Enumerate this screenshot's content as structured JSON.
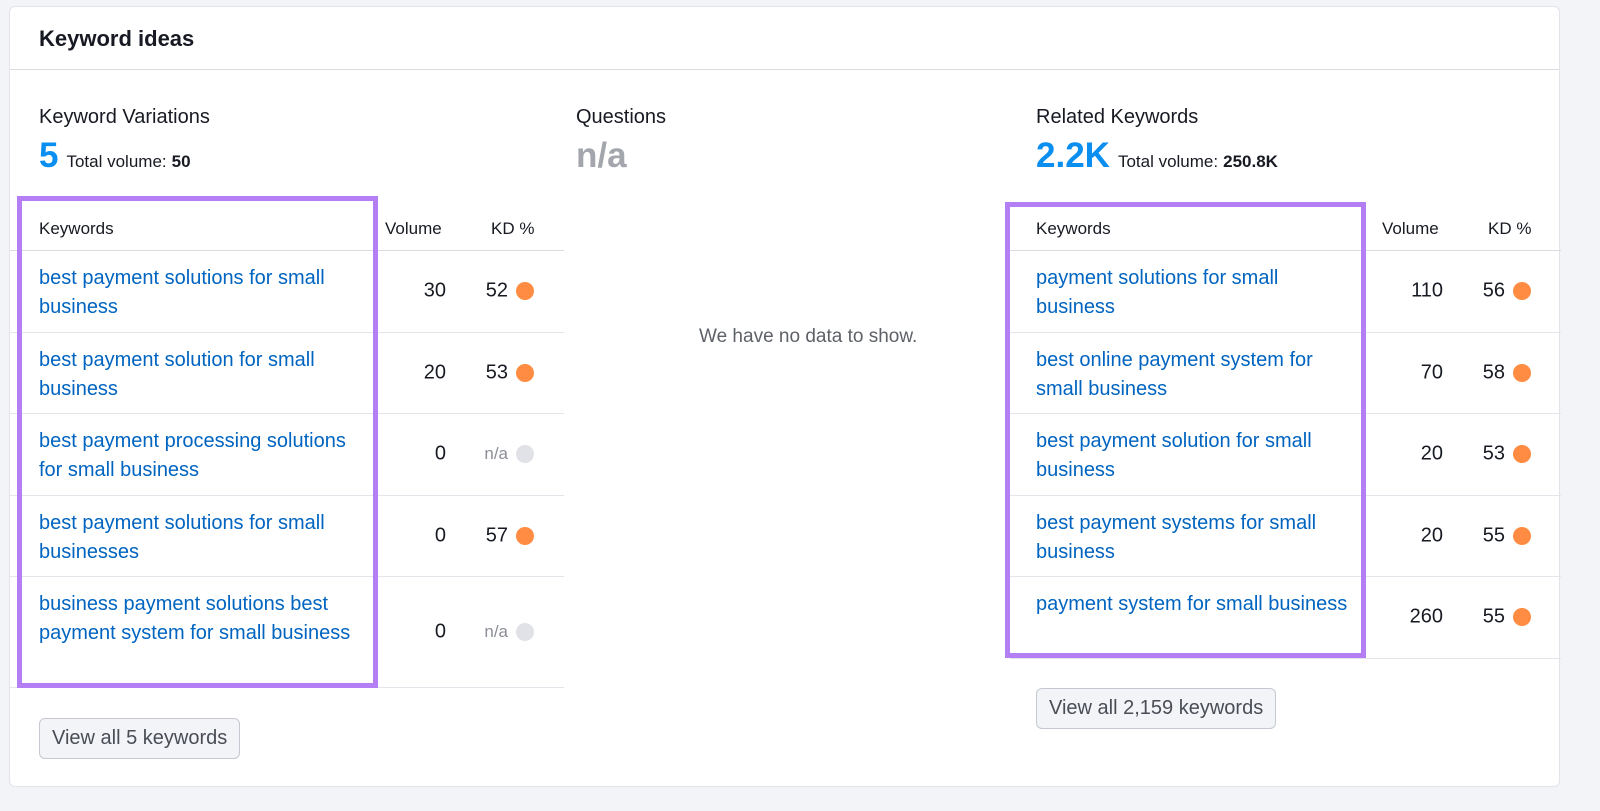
{
  "card": {
    "title": "Keyword ideas"
  },
  "variations": {
    "title": "Keyword Variations",
    "count": "5",
    "total_volume_label": "Total volume:",
    "total_volume": "50",
    "columns": {
      "keywords": "Keywords",
      "volume": "Volume",
      "kd": "KD %"
    },
    "rows": [
      {
        "keyword": "best payment solutions for small business",
        "volume": "30",
        "kd": "52",
        "kd_color": "#ff8c42"
      },
      {
        "keyword": "best payment solution for small business",
        "volume": "20",
        "kd": "53",
        "kd_color": "#ff8c42"
      },
      {
        "keyword": "best payment processing solutions for small business",
        "volume": "0",
        "kd": "n/a",
        "kd_color": "#e1e2e8"
      },
      {
        "keyword": "best payment solutions for small businesses",
        "volume": "0",
        "kd": "57",
        "kd_color": "#ff8c42"
      },
      {
        "keyword": "business payment solutions best payment system for small business",
        "volume": "0",
        "kd": "n/a",
        "kd_color": "#e1e2e8"
      }
    ],
    "view_all_label": "View all 5 keywords"
  },
  "questions": {
    "title": "Questions",
    "count": "n/a",
    "empty_message": "We have no data to show."
  },
  "related": {
    "title": "Related Keywords",
    "count": "2.2K",
    "total_volume_label": "Total volume:",
    "total_volume": "250.8K",
    "columns": {
      "keywords": "Keywords",
      "volume": "Volume",
      "kd": "KD %"
    },
    "rows": [
      {
        "keyword": "payment solutions for small business",
        "volume": "110",
        "kd": "56",
        "kd_color": "#ff8c42"
      },
      {
        "keyword": "best online payment system for small business",
        "volume": "70",
        "kd": "58",
        "kd_color": "#ff8c42"
      },
      {
        "keyword": "best payment solution for small business",
        "volume": "20",
        "kd": "53",
        "kd_color": "#ff8c42"
      },
      {
        "keyword": "best payment systems for small business",
        "volume": "20",
        "kd": "55",
        "kd_color": "#ff8c42"
      },
      {
        "keyword": "payment system for small business",
        "volume": "260",
        "kd": "55",
        "kd_color": "#ff8c42"
      }
    ],
    "view_all_label": "View all 2,159 keywords"
  },
  "colors": {
    "accent": "#0a8ff0",
    "link": "#0064c0",
    "highlight": "#b47ff5",
    "kd_orange": "#ff8c42",
    "kd_na": "#e1e2e8"
  }
}
